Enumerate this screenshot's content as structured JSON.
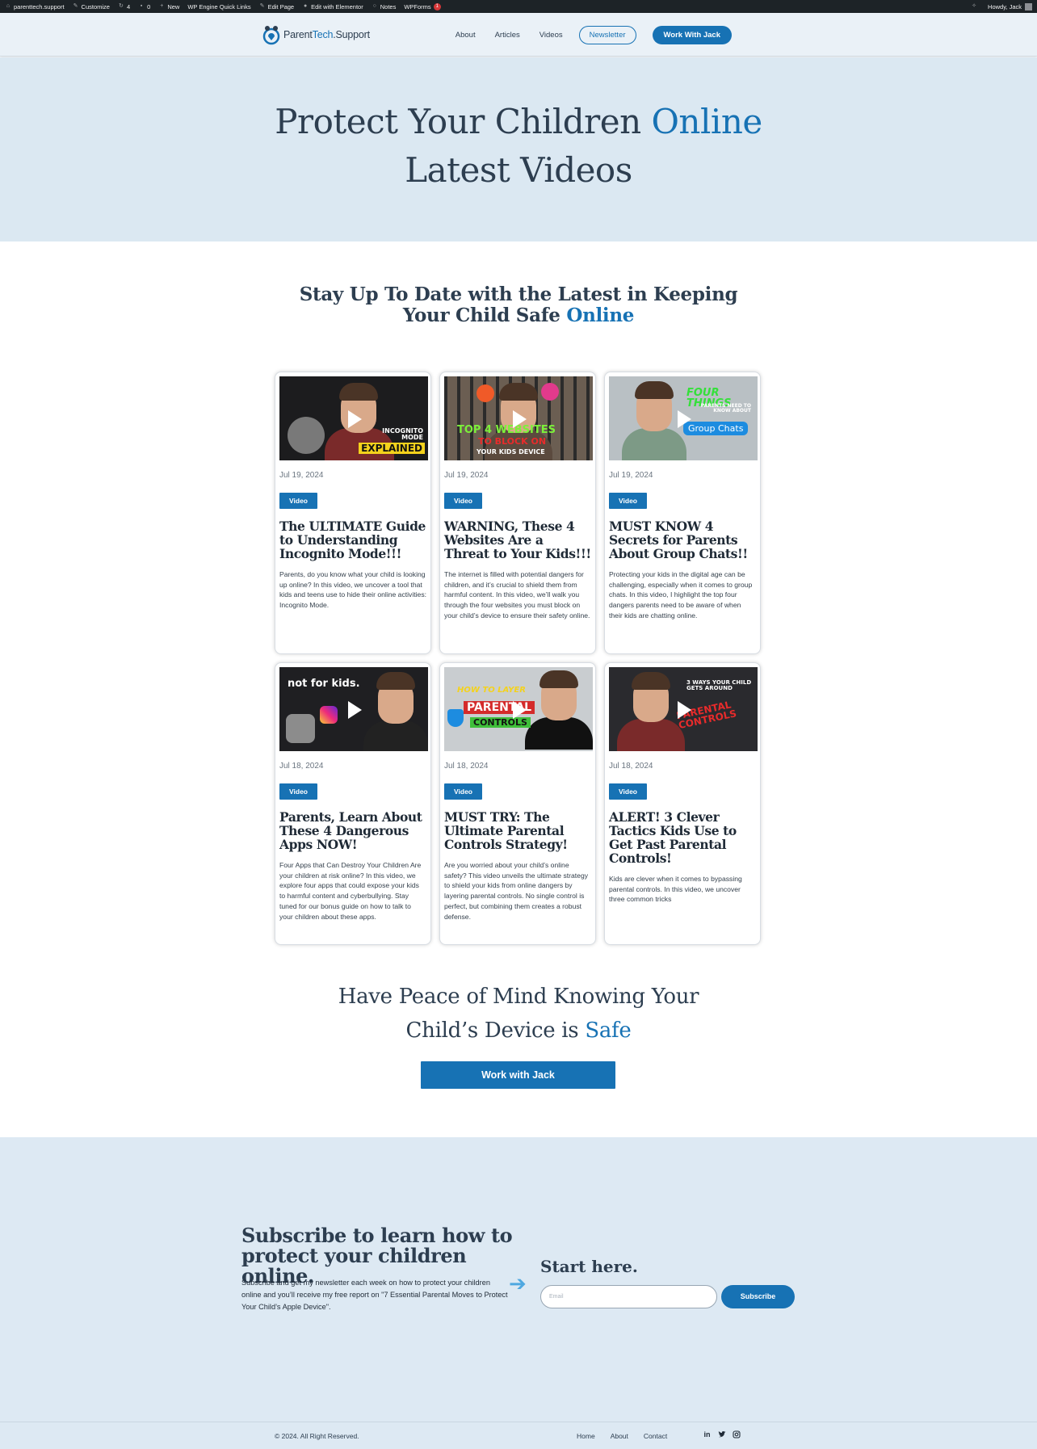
{
  "admin_bar": {
    "site": "parenttech.support",
    "customize": "Customize",
    "updates": "4",
    "comments": "0",
    "new": "New",
    "wpengine": "WP Engine Quick Links",
    "edit_page": "Edit Page",
    "elementor": "Edit with Elementor",
    "notes": "Notes",
    "wpforms": "WPForms",
    "wpforms_badge": "1",
    "howdy": "Howdy, Jack"
  },
  "header": {
    "logo_part1": "Parent",
    "logo_part2": "Tech",
    "logo_part3": ".Support",
    "nav": [
      "About",
      "Articles",
      "Videos"
    ],
    "newsletter_label": "Newsletter",
    "work_label": "Work With Jack"
  },
  "hero": {
    "line1_a": "Protect Your Children ",
    "line1_b": "Online",
    "line2": "Latest Videos"
  },
  "section": {
    "title_a": "Stay Up To Date with the Latest in Keeping Your Child Safe ",
    "title_b": "Online"
  },
  "cards": [
    {
      "date": "Jul 19, 2024",
      "tag": "Video",
      "title": "The ULTIMATE Guide to Understanding Incognito Mode!!!",
      "desc": "Parents, do you know what your child is looking up online? In this video, we uncover a tool that kids and teens use to hide their online activities: Incognito Mode.",
      "thumb_text1": "INCOGNITO MODE",
      "thumb_text2": "EXPLAINED"
    },
    {
      "date": "Jul 19, 2024",
      "tag": "Video",
      "title": "WARNING, These 4 Websites Are a Threat to Your Kids!!!",
      "desc": "The internet is filled with potential dangers for children, and it’s crucial to shield them from harmful content. In this video, we’ll walk you through the four websites you must block on your child’s device to ensure their safety online.",
      "thumb_text1": "TOP 4 WEBSITES",
      "thumb_text2": "TO BLOCK ON",
      "thumb_text3": "YOUR KIDS DEVICE"
    },
    {
      "date": "Jul 19, 2024",
      "tag": "Video",
      "title": "MUST KNOW 4 Secrets for Parents About Group Chats!!",
      "desc": "Protecting your kids in the digital age can be challenging, especially when it comes to group chats. In this video, I highlight the top four dangers parents need to be aware of when their kids are chatting online.",
      "thumb_text1": "FOUR THINGS",
      "thumb_text2": "PARENTS NEED TO KNOW ABOUT",
      "thumb_text3": "Group Chats"
    },
    {
      "date": "Jul 18, 2024",
      "tag": "Video",
      "title": "Parents, Learn About These 4 Dangerous Apps NOW!",
      "desc": "Four Apps that Can Destroy Your Children Are your children at risk online? In this video, we explore four apps that could expose your kids to harmful content and cyberbullying. Stay tuned for our bonus guide on how to talk to your children about these apps.",
      "thumb_text1": "not for kids."
    },
    {
      "date": "Jul 18, 2024",
      "tag": "Video",
      "title": "MUST TRY: The Ultimate Parental Controls Strategy!",
      "desc": "Are you worried about your child’s online safety? This video unveils the ultimate strategy to shield your kids from online dangers by layering parental controls. No single control is perfect, but combining them creates a robust defense.",
      "thumb_text1": "HOW TO LAYER",
      "thumb_text2": "PARENTAL",
      "thumb_text3": "CONTROLS"
    },
    {
      "date": "Jul 18, 2024",
      "tag": "Video",
      "title": "ALERT! 3 Clever Tactics Kids Use to Get Past Parental Controls!",
      "desc": "Kids are clever when it comes to bypassing parental controls. In this video, we uncover three common tricks",
      "thumb_text1": "3 WAYS YOUR CHILD GETS AROUND",
      "thumb_text2": "PARENTAL CONTROLS"
    }
  ],
  "cta": {
    "line1": "Have Peace of Mind Knowing Your",
    "line2_a": "Child’s Device is ",
    "line2_b": "Safe",
    "button": "Work with Jack"
  },
  "subscribe": {
    "title": "Subscribe to learn how to protect your children online.",
    "desc": "Subscribe and get my newsletter each week on how to protect your children online and you’ll receive my free report on \"7 Essential Parental Moves to Protect Your Child’s Apple Device\".",
    "start": "Start here.",
    "email_placeholder": "Email",
    "button": "Subscribe"
  },
  "footer": {
    "copyright": "© 2024. All Right Reserved.",
    "links": [
      "Home",
      "About",
      "Contact"
    ],
    "social": [
      "linkedin-icon",
      "twitter-icon",
      "instagram-icon"
    ]
  },
  "colors": {
    "accent": "#1772b4",
    "hero_bg": "#dbe8f2",
    "text": "#2d3e50"
  }
}
